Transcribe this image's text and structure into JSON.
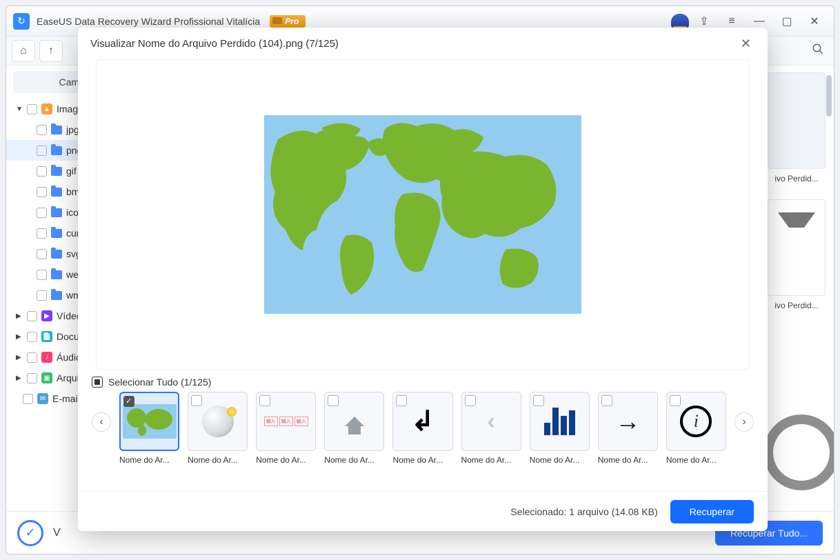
{
  "app": {
    "title": "EaseUS Data Recovery Wizard Profissional Vitalícia",
    "pro_badge": "Pro"
  },
  "titlebar_icons": {
    "share": "share-icon",
    "menu": "menu-icon",
    "minimize": "minimize-icon",
    "maximize": "maximize-icon",
    "close": "close-icon"
  },
  "sidebar": {
    "path_label": "Caminho",
    "cat_images": "Imagens",
    "folders": [
      "jpg",
      "png",
      "gif",
      "bmp",
      "ico",
      "cur",
      "svg",
      "webp",
      "wmf"
    ],
    "cat_video": "Vídeo",
    "cat_doc": "Documentos",
    "cat_audio": "Áudio",
    "cat_archive": "Arquivos",
    "cat_email": "E-mail"
  },
  "grid": {
    "peek1_label": "ivo Perdid...",
    "peek2_label": "ivo Perdid..."
  },
  "footer": {
    "recover_all": "Recuperar Tudo..."
  },
  "modal": {
    "title": "Visualizar Nome do Arquivo Perdido (104).png (7/125)",
    "select_all": "Selecionar Tudo (1/125)",
    "thumb_label": "Nome do Ar...",
    "status": "Selecionado: 1 arquivo (14.08 KB)",
    "recover": "Recuperar"
  }
}
